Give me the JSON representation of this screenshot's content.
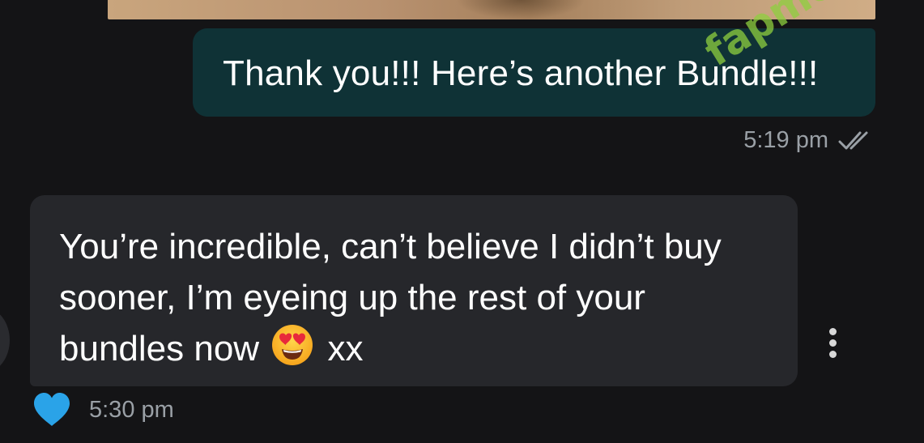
{
  "thread": {
    "top_media": {
      "kind": "photo-attachment-cropped"
    },
    "messages": [
      {
        "direction": "outgoing",
        "text": "Thank you!!! Here’s another Bundle!!!",
        "time": "5:19 pm",
        "status_icon": "double-check-icon"
      },
      {
        "direction": "incoming",
        "lines": [
          "You’re incredible, can’t believe I didn’t buy",
          "sooner, I’m eyeing up the rest of your",
          "bundles now"
        ],
        "emoji": "heart-eyes-emoji",
        "suffix": "xx",
        "time": "5:30 pm",
        "reaction_icon": "heart-icon",
        "menu_icon": "more-vertical-icon"
      }
    ]
  },
  "watermark": {
    "text": "fapmelu.com"
  },
  "colors": {
    "background": "#141416",
    "outgoing_bubble": "#0f3236",
    "incoming_bubble": "#26272b",
    "timestamp": "#9aa0a6",
    "heart": "#2aa3e8",
    "watermark": "#8ecf3f"
  }
}
